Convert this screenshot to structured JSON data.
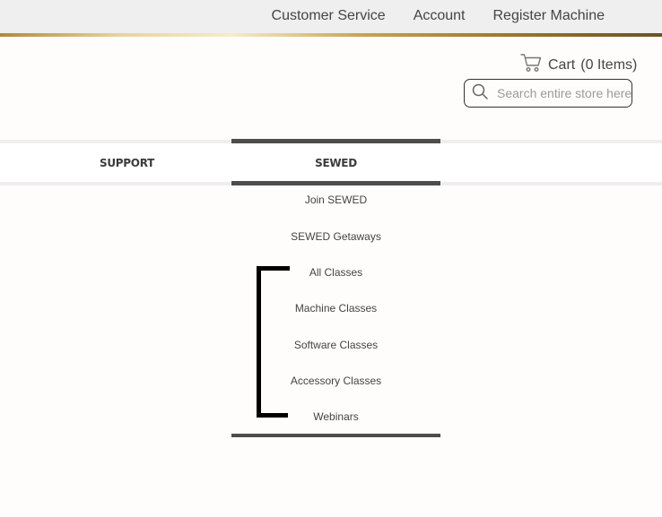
{
  "header": {
    "links": [
      "Customer Service",
      "Account",
      "Register Machine"
    ]
  },
  "cart": {
    "icon": "cart-icon",
    "label": "Cart",
    "count": "(0 Items)"
  },
  "search": {
    "icon": "search-icon",
    "placeholder": "Search entire store here..."
  },
  "nav": {
    "support_label": "SUPPORT",
    "sewed_label": "SEWED"
  },
  "dropdown": {
    "items": [
      "Join SEWED",
      "SEWED Getaways",
      "All Classes",
      "Machine Classes",
      "Software Classes",
      "Accessory Classes",
      "Webinars"
    ]
  },
  "colors": {
    "topbar": "#efefef",
    "accent_gold": "#c9a24e",
    "active_bar": "#4d4d4d",
    "annotation": "#000000"
  }
}
